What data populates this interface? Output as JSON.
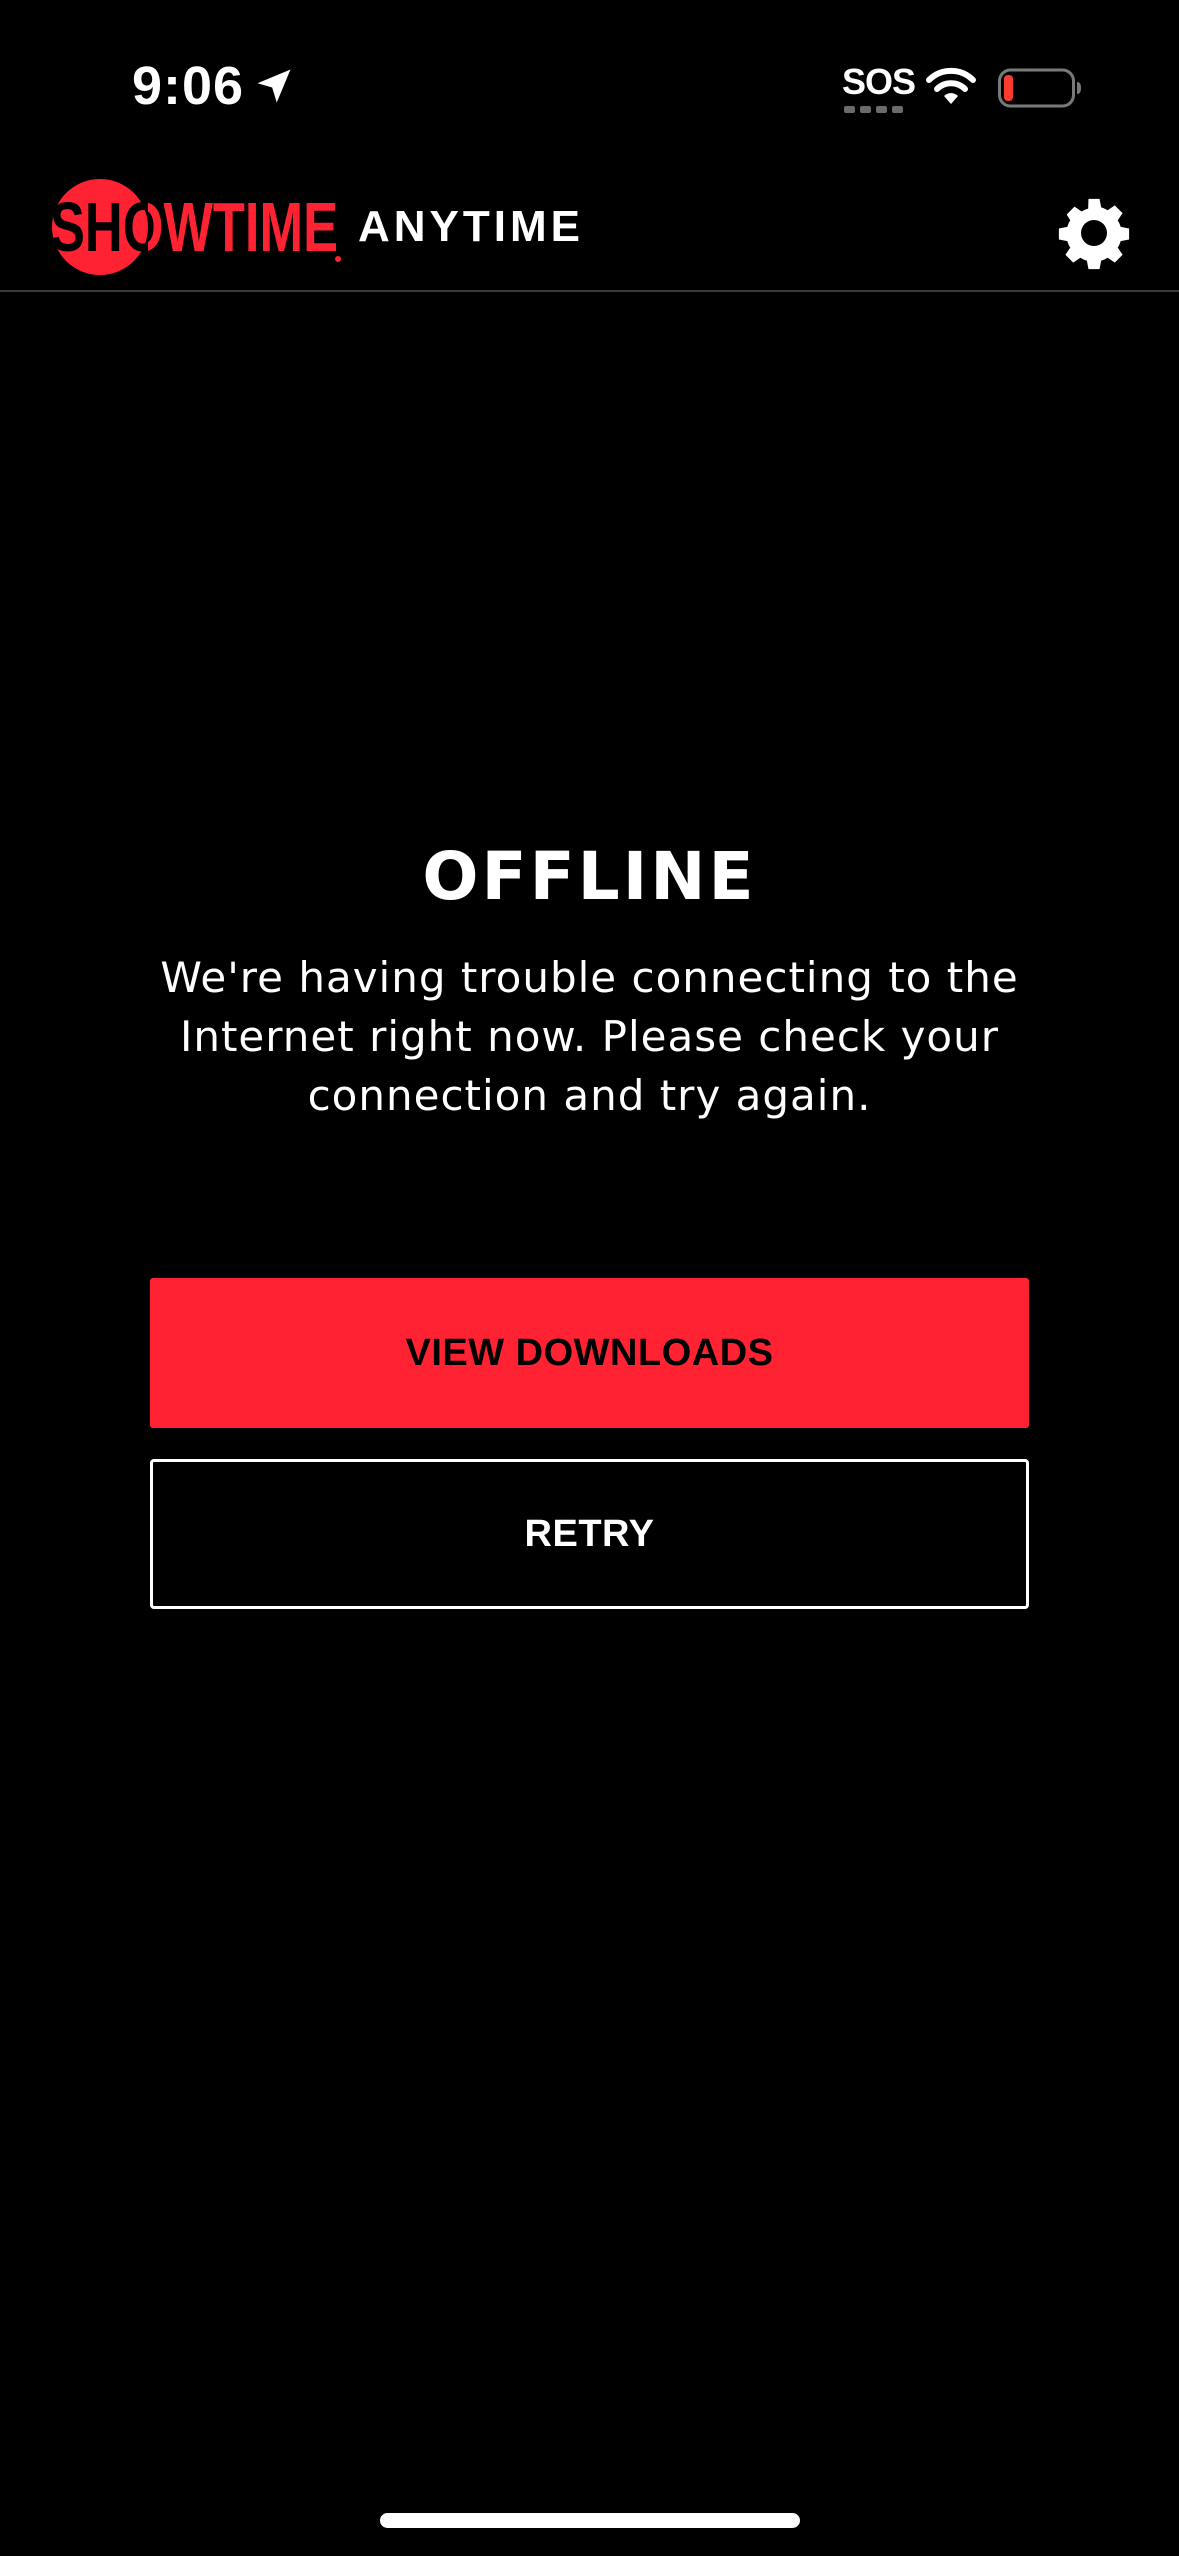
{
  "status_bar": {
    "time": "9:06",
    "sos_label": "SOS",
    "location_icon": "location-arrow-icon",
    "wifi_icon": "wifi-icon",
    "battery_icon": "battery-low-icon",
    "battery_level": 0.12
  },
  "header": {
    "brand_name": "SHOWTIME",
    "product_name": "ANYTIME",
    "settings_icon": "gear-icon"
  },
  "offline": {
    "title": "OFFLINE",
    "message": "We're having trouble connecting to the Internet right now. Please check your connection and try again."
  },
  "actions": {
    "view_downloads_label": "VIEW DOWNLOADS",
    "retry_label": "RETRY"
  },
  "colors": {
    "brand_red": "#ff2233",
    "background": "#000000",
    "text": "#ffffff"
  }
}
